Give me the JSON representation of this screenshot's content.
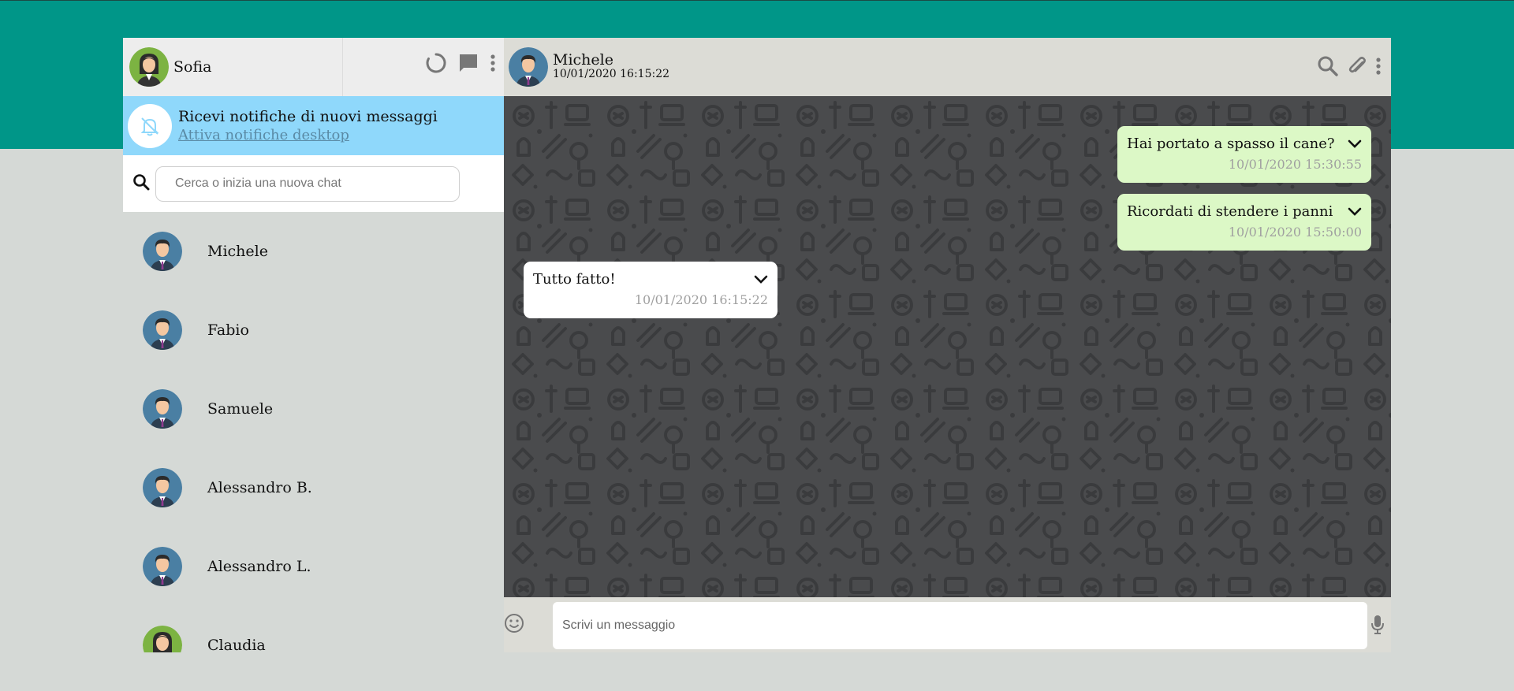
{
  "user": {
    "name": "Sofia"
  },
  "notification": {
    "title": "Ricevi notifiche di nuovi messaggi",
    "link": "Attiva notifiche desktop"
  },
  "search": {
    "placeholder": "Cerca o inizia una nuova chat"
  },
  "contacts": [
    {
      "name": "Michele",
      "avatar": "male"
    },
    {
      "name": "Fabio",
      "avatar": "male"
    },
    {
      "name": "Samuele",
      "avatar": "male"
    },
    {
      "name": "Alessandro B.",
      "avatar": "male"
    },
    {
      "name": "Alessandro L.",
      "avatar": "male"
    },
    {
      "name": "Claudia",
      "avatar": "female"
    }
  ],
  "chat": {
    "contact_name": "Michele",
    "last_seen": "10/01/2020 16:15:22",
    "messages": [
      {
        "text": "Hai portato a spasso il cane?",
        "time": "10/01/2020 15:30:55",
        "direction": "sent"
      },
      {
        "text": "Ricordati di stendere i panni",
        "time": "10/01/2020 15:50:00",
        "direction": "sent"
      },
      {
        "text": "Tutto fatto!",
        "time": "10/01/2020 16:15:22",
        "direction": "received"
      }
    ]
  },
  "composer": {
    "placeholder": "Scrivi un messaggio"
  },
  "colors": {
    "header_band": "#009688",
    "page_background": "#d5d9d6",
    "notification_bg": "#8fd8fb",
    "sent_bubble": "#dcf8c6",
    "received_bubble": "#ffffff",
    "chat_background": "#4a4b4d"
  },
  "icons": [
    "status-icon",
    "new-chat-icon",
    "menu-icon",
    "bell-off-icon",
    "search-icon",
    "attach-icon",
    "chevron-down-icon",
    "emoji-icon",
    "mic-icon"
  ]
}
